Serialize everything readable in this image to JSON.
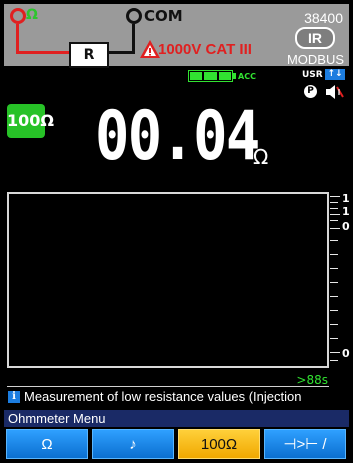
{
  "terminals": {
    "ohm_label": "Ω",
    "com_label": "COM",
    "resistor_label": "R",
    "category_label": "1000V CAT III"
  },
  "device": {
    "model": "38400",
    "ir_label": "IR",
    "modbus_label": "MODBUS"
  },
  "status": {
    "battery_cells": 3,
    "acc_label": "ACC",
    "usr_label": "USR",
    "usr_arrows": "↑↓",
    "p_label": "P"
  },
  "range_badge": "100Ω",
  "reading": {
    "value": "00.04",
    "unit": "Ω"
  },
  "graph": {
    "scale_labels": [
      "1",
      "1",
      "0",
      "0"
    ],
    "time_label": ">88s"
  },
  "info": {
    "icon_label": "i",
    "text": "Measurement of low resistance values (Injection"
  },
  "menu": {
    "title": "Ohmmeter Menu",
    "softkeys": [
      {
        "label": "Ω"
      },
      {
        "label": "♪"
      },
      {
        "label": "100Ω"
      },
      {
        "label": "⊣>⊢ / ⊣>⊢"
      }
    ]
  },
  "colors": {
    "accent_green": "#27c227",
    "warning_red": "#e02020",
    "softkey_blue": "#0b6fd0",
    "softkey_active": "#f0a800",
    "menu_bar": "#1a2a66"
  }
}
